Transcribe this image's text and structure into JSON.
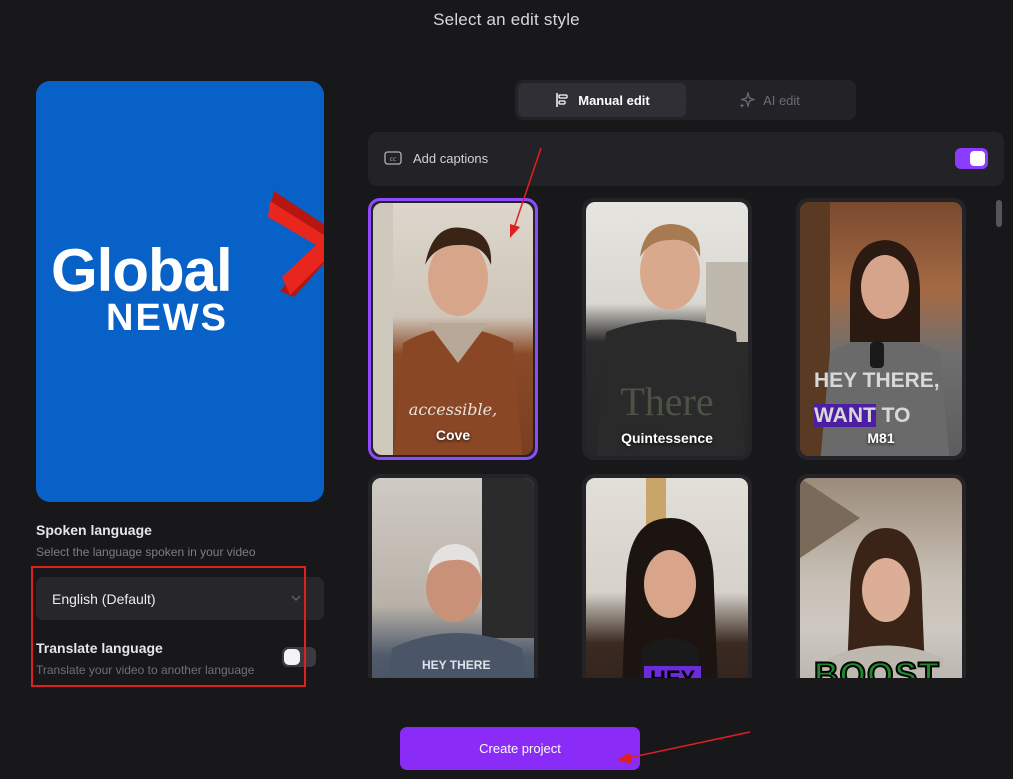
{
  "title": "Select an edit style",
  "preview": {
    "logo_line1": "Global",
    "logo_line2": "NEWS",
    "logo_accent": "#e8261e",
    "background": "#0861c6"
  },
  "spoken": {
    "label": "Spoken language",
    "sublabel": "Select the language spoken in your video",
    "selected": "English (Default)"
  },
  "translate": {
    "label": "Translate language",
    "sublabel": "Translate your video to another language",
    "enabled": false
  },
  "tabs": [
    {
      "label": "Manual edit",
      "icon": "manual-edit-icon",
      "active": true
    },
    {
      "label": "AI edit",
      "icon": "sparkle-icon",
      "active": false
    }
  ],
  "captions": {
    "label": "Add captions",
    "icon": "cc-icon",
    "enabled": true
  },
  "styles": [
    {
      "name": "Cove",
      "overlay": "accessible,",
      "selected": true
    },
    {
      "name": "Quintessence",
      "overlay": "There",
      "selected": false
    },
    {
      "name": "M81",
      "overlay_line1": "HEY THERE,",
      "overlay_line2_hl": "WANT",
      "overlay_line2": " TO",
      "selected": false
    },
    {
      "name": "",
      "overlay": "HEY THERE",
      "selected": false
    },
    {
      "name": "",
      "overlay": "HEY",
      "selected": false
    },
    {
      "name": "",
      "overlay": "BOOST",
      "selected": false
    }
  ],
  "create_button": "Create project",
  "colors": {
    "accent": "#8a2bf7",
    "annotation": "#e02020"
  }
}
